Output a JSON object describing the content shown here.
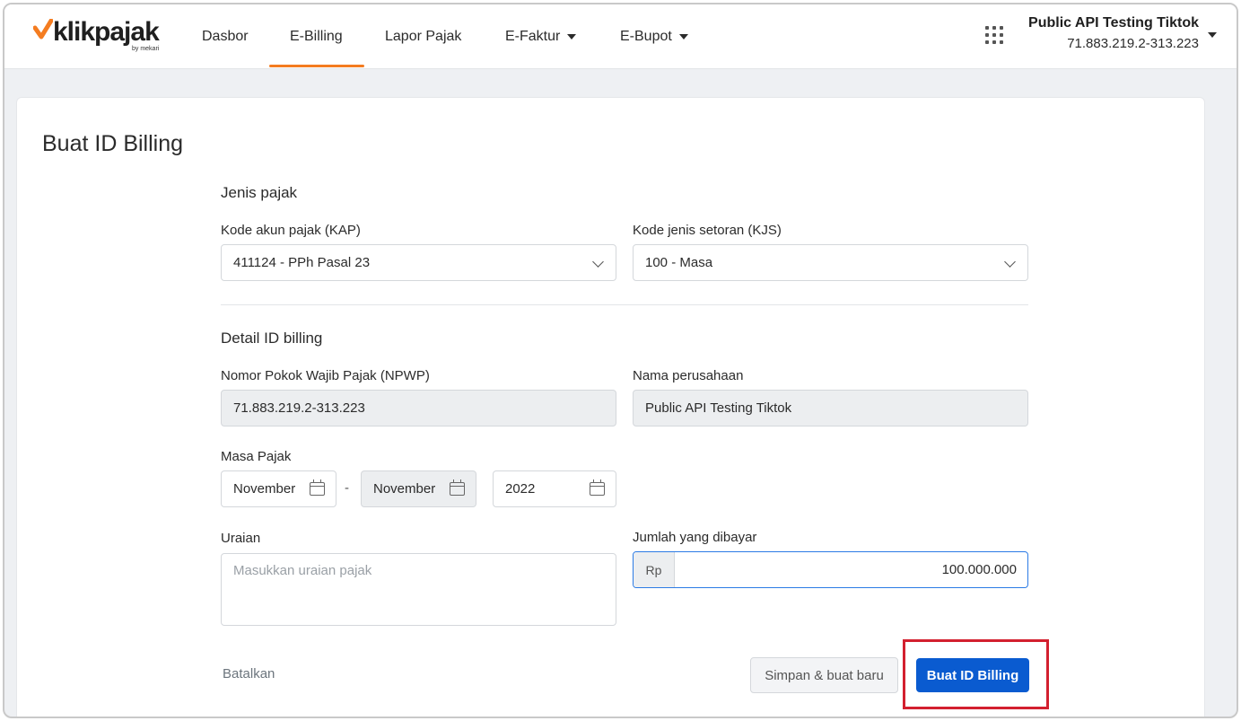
{
  "brand": {
    "logo_text": "klikpajak",
    "logo_sub": "by mekari",
    "accent": "#f47c20",
    "primary": "#0a5bd0",
    "highlight": "#d3202f"
  },
  "nav": {
    "items": [
      {
        "label": "Dasbor",
        "dropdown": false,
        "active": false
      },
      {
        "label": "E-Billing",
        "dropdown": false,
        "active": true
      },
      {
        "label": "Lapor Pajak",
        "dropdown": false,
        "active": false
      },
      {
        "label": "E-Faktur",
        "dropdown": true,
        "active": false
      },
      {
        "label": "E-Bupot",
        "dropdown": true,
        "active": false
      }
    ],
    "apps_icon": "grid-icon"
  },
  "account": {
    "name": "Public API Testing Tiktok",
    "npwp": "71.883.219.2-313.223"
  },
  "page": {
    "title": "Buat ID Billing"
  },
  "jenis_pajak": {
    "section_title": "Jenis pajak",
    "kap_label": "Kode akun pajak (KAP)",
    "kap_value": "411124 - PPh Pasal 23",
    "kjs_label": "Kode jenis setoran (KJS)",
    "kjs_value": "100 - Masa"
  },
  "detail": {
    "section_title": "Detail ID billing",
    "npwp_label": "Nomor Pokok Wajib Pajak (NPWP)",
    "npwp_value": "71.883.219.2-313.223",
    "company_label": "Nama perusahaan",
    "company_value": "Public API Testing Tiktok",
    "masa_label": "Masa Pajak",
    "masa_start": "November",
    "masa_separator": "-",
    "masa_end": "November",
    "tahun": "2022",
    "uraian_label": "Uraian",
    "uraian_placeholder": "Masukkan uraian pajak",
    "jumlah_label": "Jumlah yang dibayar",
    "jumlah_prefix": "Rp",
    "jumlah_value": "100.000.000"
  },
  "actions": {
    "cancel": "Batalkan",
    "save_new": "Simpan & buat baru",
    "submit": "Buat ID Billing"
  }
}
